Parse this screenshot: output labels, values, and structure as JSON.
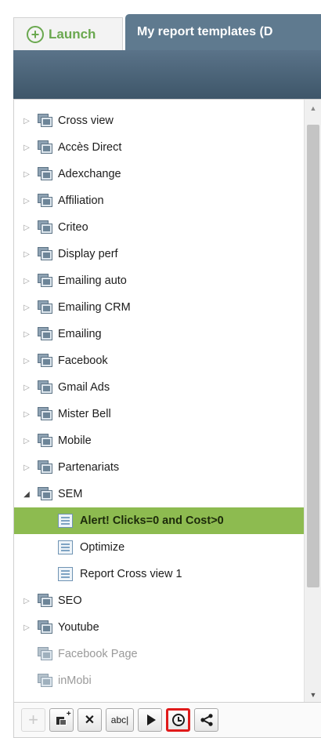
{
  "tabs": {
    "launch_label": "Launch",
    "launch_icon": "plus-circle-icon",
    "templates_label": "My report templates (D"
  },
  "tree": {
    "folders_before": [
      {
        "label": "Cross view"
      },
      {
        "label": "Accès Direct"
      },
      {
        "label": "Adexchange"
      },
      {
        "label": "Affiliation"
      },
      {
        "label": "Criteo"
      },
      {
        "label": "Display perf"
      },
      {
        "label": "Emailing auto"
      },
      {
        "label": "Emailing CRM"
      },
      {
        "label": "Emailing"
      },
      {
        "label": "Facebook"
      },
      {
        "label": "Gmail Ads"
      },
      {
        "label": "Mister Bell"
      },
      {
        "label": "Mobile"
      },
      {
        "label": "Partenariats"
      }
    ],
    "expanded_folder": {
      "label": "SEM",
      "children": [
        {
          "label": "Alert! Clicks=0 and Cost>0",
          "selected": true
        },
        {
          "label": "Optimize",
          "selected": false
        },
        {
          "label": "Report Cross view 1",
          "selected": false
        }
      ]
    },
    "folders_after": [
      {
        "label": "SEO"
      },
      {
        "label": "Youtube"
      }
    ],
    "dim_folders": [
      {
        "label": "Facebook Page"
      },
      {
        "label": "inMobi"
      }
    ]
  },
  "toolbar": {
    "buttons": [
      {
        "name": "add-button",
        "icon": "plus-icon",
        "enabled": false
      },
      {
        "name": "new-folder-button",
        "icon": "new-folder-icon",
        "enabled": true
      },
      {
        "name": "delete-button",
        "icon": "close-icon",
        "enabled": true
      },
      {
        "name": "rename-button",
        "icon": "rename-icon",
        "label": "abc|",
        "enabled": true
      },
      {
        "name": "run-button",
        "icon": "play-icon",
        "enabled": true
      },
      {
        "name": "schedule-button",
        "icon": "clock-icon",
        "enabled": true,
        "highlighted": true
      },
      {
        "name": "share-button",
        "icon": "share-icon",
        "enabled": true
      }
    ]
  },
  "colors": {
    "accent_green": "#6aa84f",
    "header_blue": "#5f7a8f",
    "selection_green": "#8dbb50",
    "highlight_red": "#e01b1b"
  }
}
